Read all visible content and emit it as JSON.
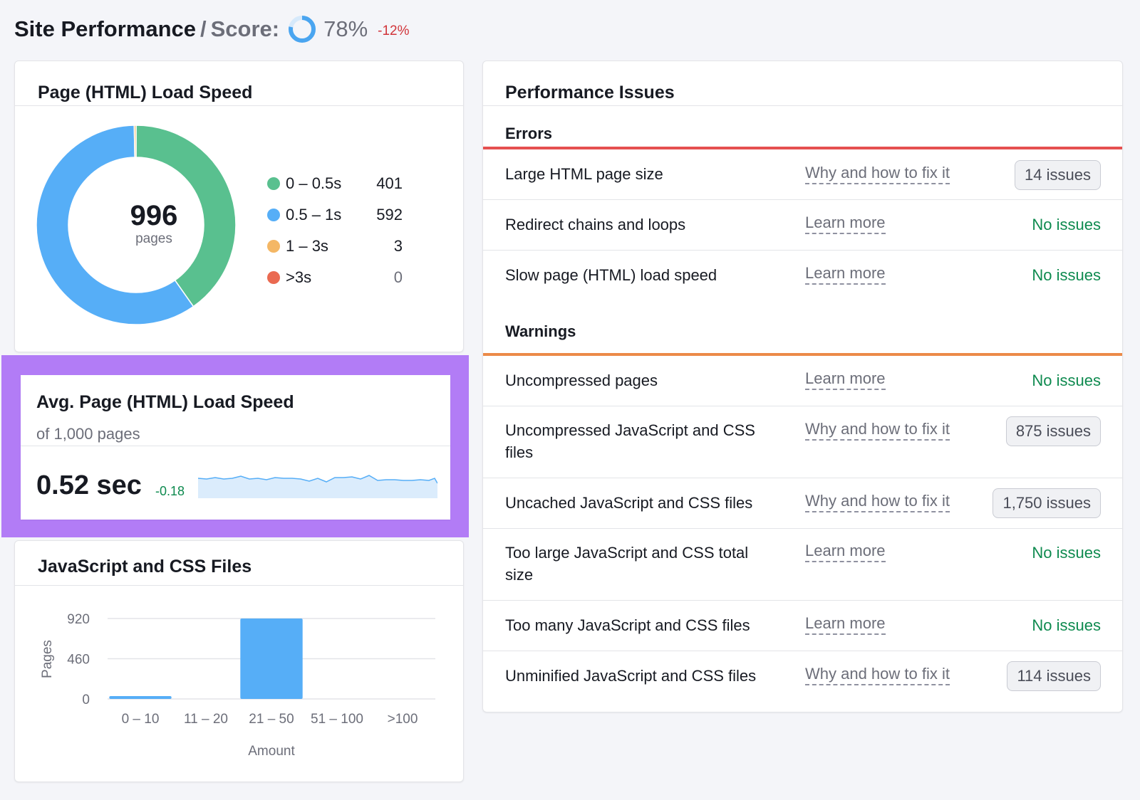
{
  "header": {
    "title": "Site Performance",
    "separator": "/",
    "score_label": "Score:",
    "score_value": "78%",
    "score_fraction": 0.78,
    "score_delta": "-12%"
  },
  "load_speed": {
    "title": "Page (HTML) Load Speed",
    "total": "996",
    "total_label": "pages",
    "legend": [
      {
        "range": "0 – 0.5s",
        "count": "401",
        "color": "#59c08f"
      },
      {
        "range": "0.5 – 1s",
        "count": "592",
        "color": "#56aef7"
      },
      {
        "range": "1 – 3s",
        "count": "3",
        "color": "#f4b765"
      },
      {
        "range": ">3s",
        "count": "0",
        "color": "#ea6a51"
      }
    ]
  },
  "avg_speed": {
    "title": "Avg. Page (HTML) Load Speed",
    "subtitle": "of 1,000 pages",
    "value": "0.52 sec",
    "delta": "-0.18"
  },
  "js_css": {
    "title": "JavaScript and CSS Files"
  },
  "chart_data": {
    "type": "bar",
    "title": "",
    "xlabel": "Amount",
    "ylabel": "Pages",
    "categories": [
      "0 – 10",
      "11 – 20",
      "21 – 50",
      "51 – 100",
      ">100"
    ],
    "values": [
      30,
      0,
      920,
      0,
      0
    ],
    "yticks": [
      "0",
      "460",
      "920"
    ],
    "ylim": [
      0,
      920
    ],
    "grid": true,
    "color": "#56aef7"
  },
  "issues": {
    "title": "Performance Issues",
    "sections": [
      {
        "label": "Errors",
        "color": "#e55050",
        "rows": [
          {
            "name": "Large HTML page size",
            "link": "Why and how to fix it",
            "status": "14 issues",
            "badge": true
          },
          {
            "name": "Redirect chains and loops",
            "link": "Learn more",
            "status": "No issues",
            "badge": false
          },
          {
            "name": "Slow page (HTML) load speed",
            "link": "Learn more",
            "status": "No issues",
            "badge": false
          }
        ]
      },
      {
        "label": "Warnings",
        "color": "#ec8a48",
        "rows": [
          {
            "name": "Uncompressed pages",
            "link": "Learn more",
            "status": "No issues",
            "badge": false
          },
          {
            "name": "Uncompressed JavaScript and CSS files",
            "link": "Why and how to fix it",
            "status": "875 issues",
            "badge": true
          },
          {
            "name": "Uncached JavaScript and CSS files",
            "link": "Why and how to fix it",
            "status": "1,750 issues",
            "badge": true
          },
          {
            "name": "Too large JavaScript and CSS total size",
            "link": "Learn more",
            "status": "No issues",
            "badge": false
          },
          {
            "name": "Too many JavaScript and CSS files",
            "link": "Learn more",
            "status": "No issues",
            "badge": false
          },
          {
            "name": "Unminified JavaScript and CSS files",
            "link": "Why and how to fix it",
            "status": "114 issues",
            "badge": true
          }
        ]
      }
    ]
  }
}
